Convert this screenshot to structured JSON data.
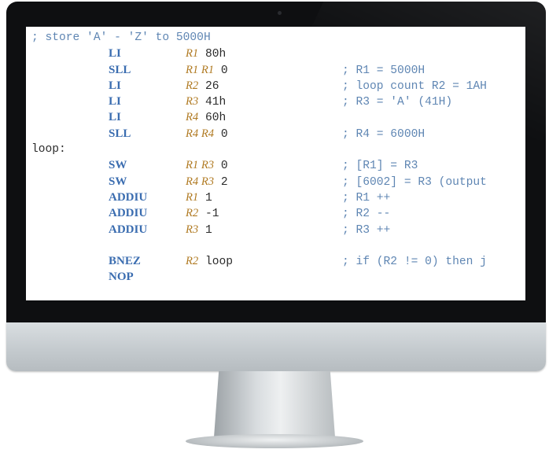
{
  "colors": {
    "mnemonic": "#3b6db0",
    "register": "#b07a22",
    "comment": "#5f86b3",
    "text": "#2b2b2b",
    "screen": "#ffffff",
    "bezel": "#0e0f11"
  },
  "editor": {
    "lines": [
      {
        "label": "",
        "mnemonic": "",
        "regs": "",
        "args": "",
        "comment": "; store 'A' - 'Z' to 5000H"
      },
      {
        "label": "",
        "mnemonic": "LI",
        "regs": "R1",
        "args": "80h",
        "comment": ""
      },
      {
        "label": "",
        "mnemonic": "SLL",
        "regs": "R1 R1",
        "args": "0",
        "comment": "; R1 = 5000H"
      },
      {
        "label": "",
        "mnemonic": "LI",
        "regs": "R2",
        "args": "26",
        "comment": "; loop count R2 = 1AH"
      },
      {
        "label": "",
        "mnemonic": "LI",
        "regs": "R3",
        "args": "41h",
        "comment": "; R3 = 'A' (41H)"
      },
      {
        "label": "",
        "mnemonic": "LI",
        "regs": "R4",
        "args": "60h",
        "comment": ""
      },
      {
        "label": "",
        "mnemonic": "SLL",
        "regs": "R4 R4",
        "args": "0",
        "comment": "; R4 = 6000H"
      },
      {
        "label": "loop:",
        "mnemonic": "",
        "regs": "",
        "args": "",
        "comment": ""
      },
      {
        "label": "",
        "mnemonic": "SW",
        "regs": "R1 R3",
        "args": "0",
        "comment": "; [R1] = R3"
      },
      {
        "label": "",
        "mnemonic": "SW",
        "regs": "R4 R3",
        "args": "2",
        "comment": "; [6002] = R3 (output"
      },
      {
        "label": "",
        "mnemonic": "ADDIU",
        "regs": "R1",
        "args": "1",
        "comment": "; R1 ++"
      },
      {
        "label": "",
        "mnemonic": "ADDIU",
        "regs": "R2",
        "args": "-1",
        "comment": "; R2 --"
      },
      {
        "label": "",
        "mnemonic": "ADDIU",
        "regs": "R3",
        "args": "1",
        "comment": "; R3 ++"
      },
      {
        "label": "",
        "mnemonic": "",
        "regs": "",
        "args": "",
        "comment": ""
      },
      {
        "label": "",
        "mnemonic": "BNEZ",
        "regs": "R2",
        "args": "loop",
        "comment": "; if (R2 != 0) then j"
      },
      {
        "label": "",
        "mnemonic": "NOP",
        "regs": "",
        "args": "",
        "comment": ""
      }
    ]
  }
}
